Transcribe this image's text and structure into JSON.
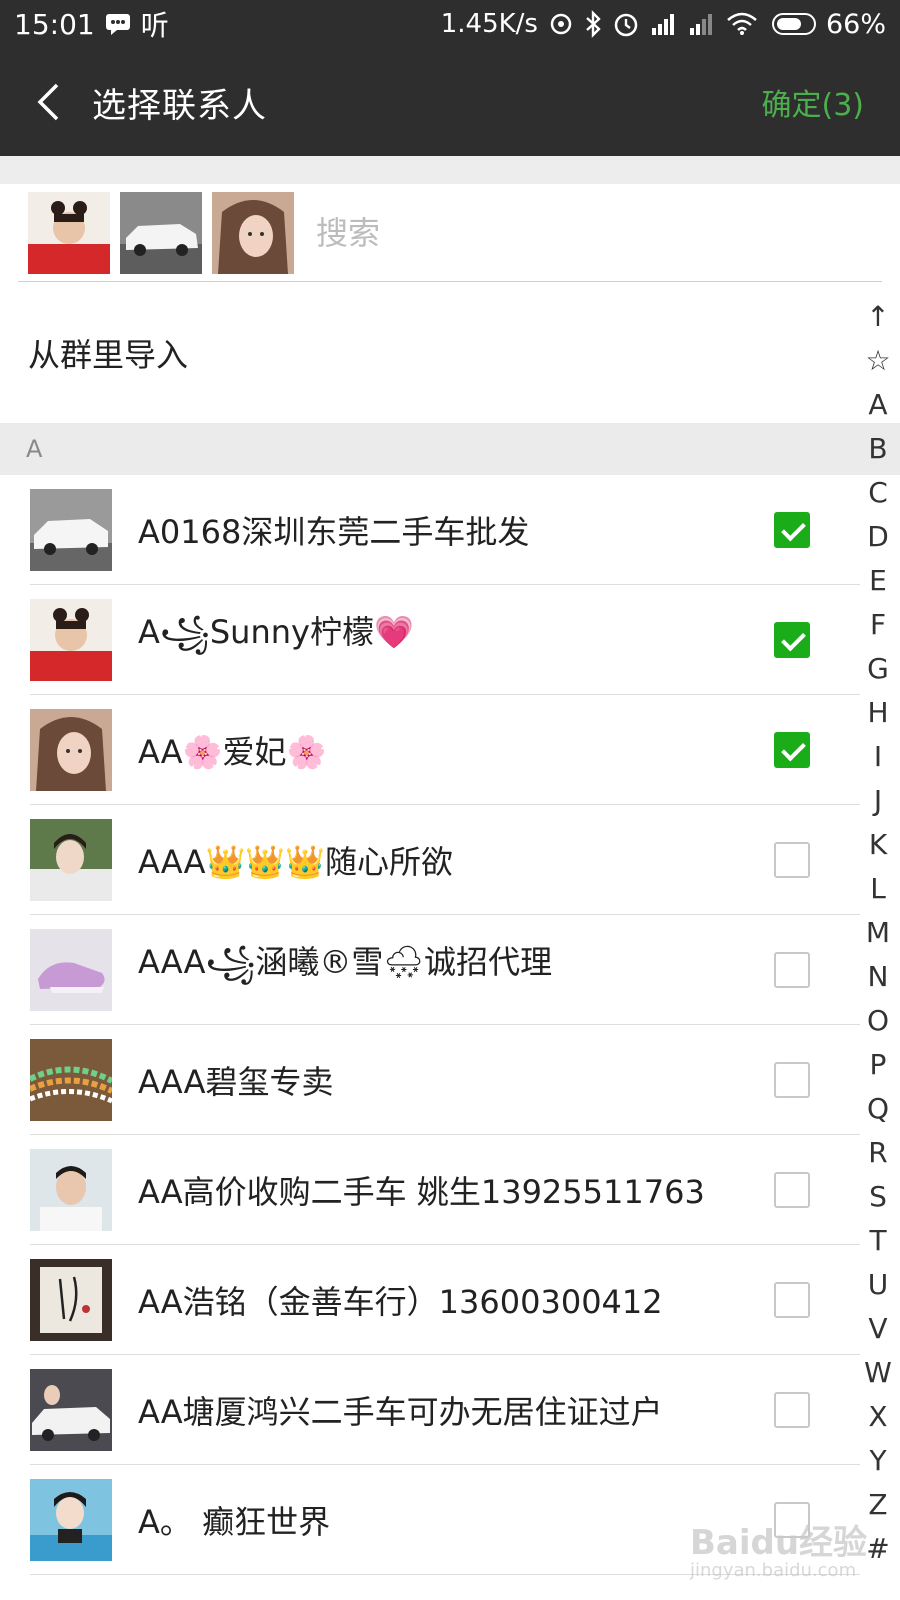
{
  "status_bar": {
    "time": "15:01",
    "listen_label": "听",
    "network_speed": "1.45K/s",
    "battery_percent": "66%"
  },
  "nav": {
    "title": "选择联系人",
    "confirm_label": "确定(3)"
  },
  "search": {
    "placeholder": "搜索"
  },
  "import_group_label": "从群里导入",
  "section": {
    "letter": "A"
  },
  "contacts": [
    {
      "name": "A0168深圳东莞二手车批发",
      "checked": true
    },
    {
      "name": "A꧁Sunny柠檬💗",
      "checked": true
    },
    {
      "name": "AA🌸爱妃🌸",
      "checked": true
    },
    {
      "name": "AAA👑👑👑随心所欲",
      "checked": false
    },
    {
      "name": "AAA꧁涵曦®雪🌨诚招代理",
      "checked": false
    },
    {
      "name": "AAA碧玺专卖",
      "checked": false
    },
    {
      "name": "AA高价收购二手车 姚生13925511763",
      "checked": false
    },
    {
      "name": "AA浩铭（金善车行）13600300412",
      "checked": false
    },
    {
      "name": "AA塘厦鸿兴二手车可办无居住证过户",
      "checked": false
    },
    {
      "name": "A。  癫狂世界",
      "checked": false
    }
  ],
  "index_bar": [
    "↑",
    "☆",
    "A",
    "B",
    "C",
    "D",
    "E",
    "F",
    "G",
    "H",
    "I",
    "J",
    "K",
    "L",
    "M",
    "N",
    "O",
    "P",
    "Q",
    "R",
    "S",
    "T",
    "U",
    "V",
    "W",
    "X",
    "Y",
    "Z",
    "#"
  ],
  "watermark": {
    "main": "Baidu经验",
    "sub": "jingyan.baidu.com"
  },
  "colors": {
    "accent": "#1aad19",
    "confirm": "#4cae4c",
    "header_bg": "#2e2e2e"
  }
}
